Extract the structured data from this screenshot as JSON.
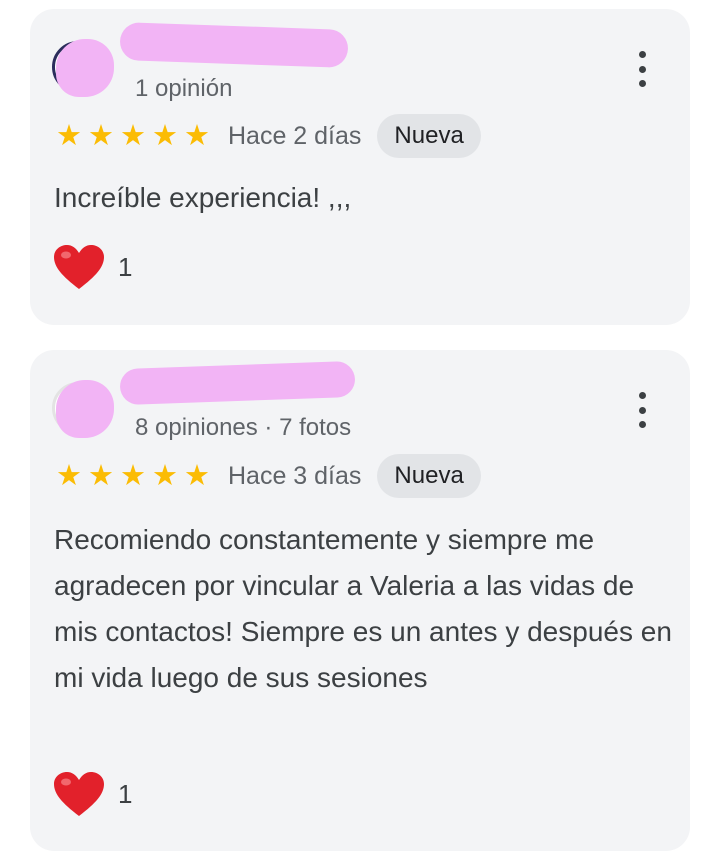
{
  "reviews": [
    {
      "meta": "1 opinión",
      "stars": 5,
      "date": "Hace 2 días",
      "badge": "Nueva",
      "text": "Increíble experiencia! ,,,",
      "likes": "1"
    },
    {
      "meta": "8 opiniones · 7 fotos",
      "stars": 5,
      "date": "Hace 3 días",
      "badge": "Nueva",
      "text": "Recomiendo constantemente y siempre me agradecen por vincular a Valeria a las vidas de mis contactos! Siempre es un antes y después en mi vida luego de sus sesiones",
      "likes": "1"
    }
  ],
  "icons": {
    "star": "star-icon",
    "heart": "heart-icon",
    "more": "more-vert-icon"
  },
  "colors": {
    "star": "#fbbc04",
    "heart": "#e2212b",
    "card_bg": "#f3f4f6",
    "badge_bg": "#e2e4e7",
    "redaction": "#f2b4f5"
  }
}
